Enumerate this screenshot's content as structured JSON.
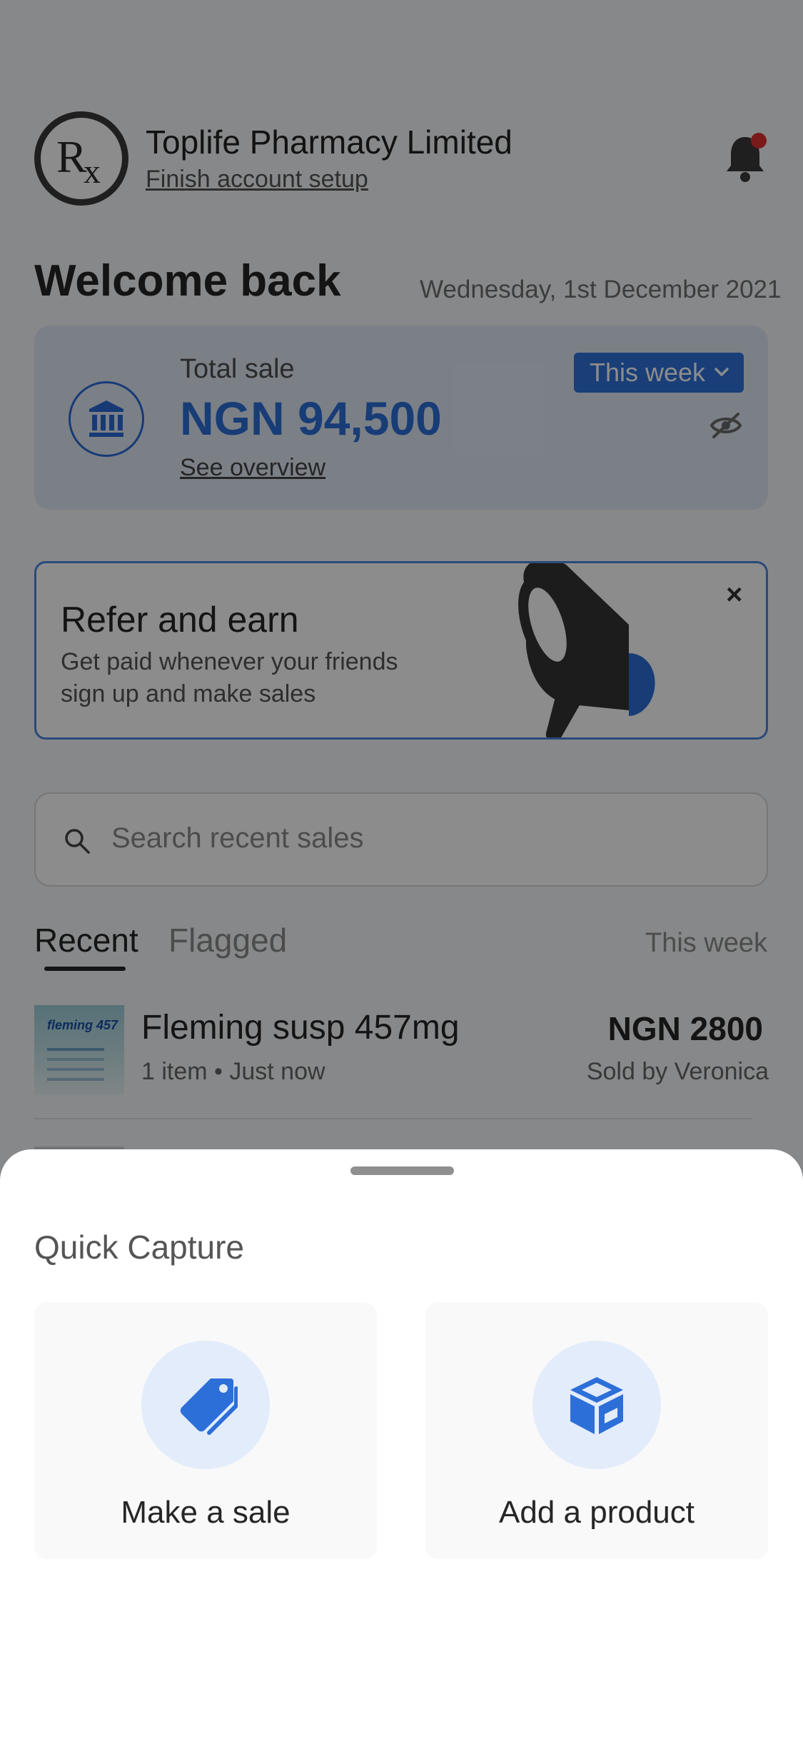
{
  "header": {
    "company_name": "Toplife Pharmacy Limited",
    "setup_link": "Finish account setup",
    "notifications_unread": true
  },
  "welcome": {
    "title": "Welcome back",
    "date": "Wednesday, 1st December 2021"
  },
  "sales_card": {
    "label": "Total sale",
    "value": "NGN 94,500",
    "overview_link": "See overview",
    "period": "This week"
  },
  "refer_card": {
    "title": "Refer and earn",
    "description": "Get paid whenever your friends sign up and make sales",
    "close": "×"
  },
  "search": {
    "placeholder": "Search recent sales"
  },
  "tabs": {
    "items": [
      "Recent",
      "Flagged"
    ],
    "active": "Recent",
    "filter": "This week"
  },
  "recent_sales": [
    {
      "name": "Fleming susp 457mg",
      "meta": "1 item • Just now",
      "price": "NGN 2800",
      "seller": "Sold by Veronica",
      "thumb_label": "fleming 457"
    }
  ],
  "quick_capture": {
    "title": "Quick Capture",
    "actions": [
      {
        "label": "Make a sale",
        "icon": "tag-icon"
      },
      {
        "label": "Add a product",
        "icon": "box-icon"
      }
    ]
  },
  "colors": {
    "accent": "#2E72DB",
    "overlay": "rgba(0,0,0,0.45)",
    "notification_dot": "#E03131"
  }
}
